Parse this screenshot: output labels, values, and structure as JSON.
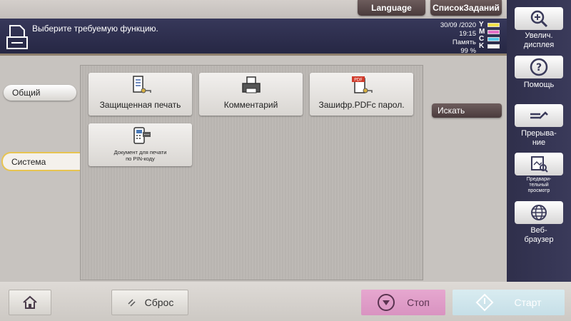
{
  "top_bar": {
    "language_label": "Language",
    "job_list_label": "СписокЗаданий"
  },
  "header": {
    "message": "Выберите требуемую функцию.",
    "date": "30/09 /2020",
    "time": "19:15",
    "memory_label": "Память",
    "memory_percent": "99 %",
    "toner": [
      {
        "label": "Y",
        "color": "#f2e24a"
      },
      {
        "label": "M",
        "color": "#e36fc6"
      },
      {
        "label": "C",
        "color": "#58c8e8"
      },
      {
        "label": "K",
        "color": "#2b2b2b"
      }
    ]
  },
  "left_tabs": {
    "general": "Общий",
    "system": "Система"
  },
  "functions": {
    "secure_print": "Защищенная печать",
    "comment": "Комментарий",
    "encrypted_pdf": "Зашифр.PDFс парол.",
    "pin_print": "Документ для печати\nпо PIN-коду"
  },
  "search_label": "Искать",
  "sidebar": {
    "zoom_label": "Увелич.\nдисплея",
    "help_label": "Помощь",
    "interrupt_label": "Прерыва-\nние",
    "preview_label": "Предвари-\nтельный\nпросмотр",
    "web_label": "Веб-\nбраузер"
  },
  "bottom": {
    "reset_label": "Сброс",
    "stop_label": "Стоп",
    "start_label": "Старт"
  },
  "colors": {
    "accent_yellow": "#e7c451",
    "stop_pink": "#df9cc8",
    "start_blue": "#cfe5ec",
    "header_navy": "#2d2e4d"
  }
}
